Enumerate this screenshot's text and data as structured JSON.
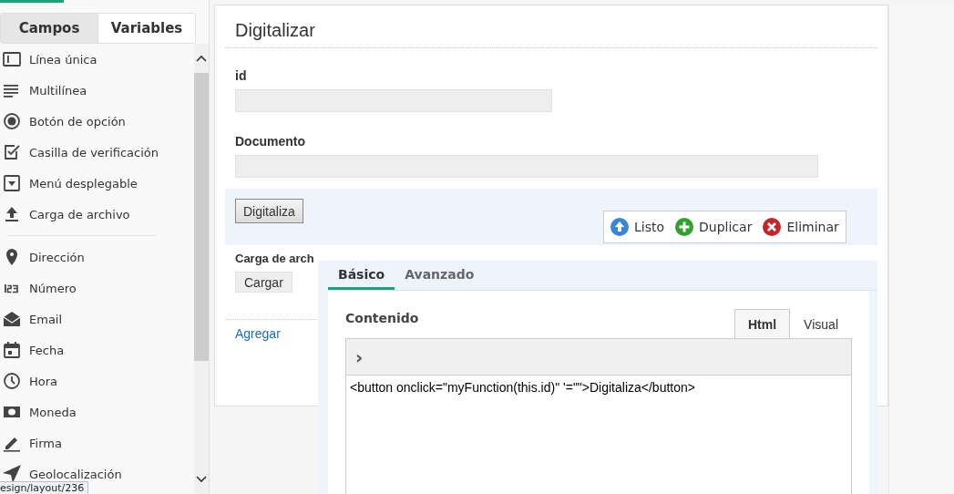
{
  "sidebar": {
    "tabs": [
      {
        "label": "Campos",
        "selected": true
      },
      {
        "label": "Variables",
        "selected": false
      }
    ],
    "field_groups": [
      [
        {
          "label": "Línea única"
        },
        {
          "label": "Multilínea"
        },
        {
          "label": "Botón de opción"
        },
        {
          "label": "Casilla de verificación"
        },
        {
          "label": "Menú desplegable"
        },
        {
          "label": "Carga de archivo"
        }
      ],
      [
        {
          "label": "Dirección"
        },
        {
          "label": "Número"
        },
        {
          "label": "Email"
        },
        {
          "label": "Fecha"
        },
        {
          "label": "Hora"
        },
        {
          "label": "Moneda"
        },
        {
          "label": "Firma"
        },
        {
          "label": "Geolocalización"
        }
      ]
    ]
  },
  "form": {
    "title": "Digitalizar",
    "fields": [
      {
        "label": "id"
      },
      {
        "label": "Documento"
      }
    ],
    "scan_button": "Digitaliza",
    "toolbar": [
      {
        "label": "Listo",
        "kind": "done"
      },
      {
        "label": "Duplicar",
        "kind": "duplicate"
      },
      {
        "label": "Eliminar",
        "kind": "delete"
      }
    ],
    "upload": {
      "label": "Carga de arch",
      "button": "Cargar"
    },
    "add_link": "Agregar"
  },
  "properties": {
    "tabs": [
      {
        "label": "Básico",
        "selected": true
      },
      {
        "label": "Avanzado",
        "selected": false
      }
    ],
    "content_label": "Contenido",
    "editor_tabs": [
      {
        "label": "Html",
        "selected": true
      },
      {
        "label": "Visual",
        "selected": false
      }
    ],
    "toolbar_glyph": "›",
    "code": "<button onclick=\"myFunction(this.id)\" '=\"\">Digitaliza</button>"
  },
  "status_url": "esign/layout/236"
}
